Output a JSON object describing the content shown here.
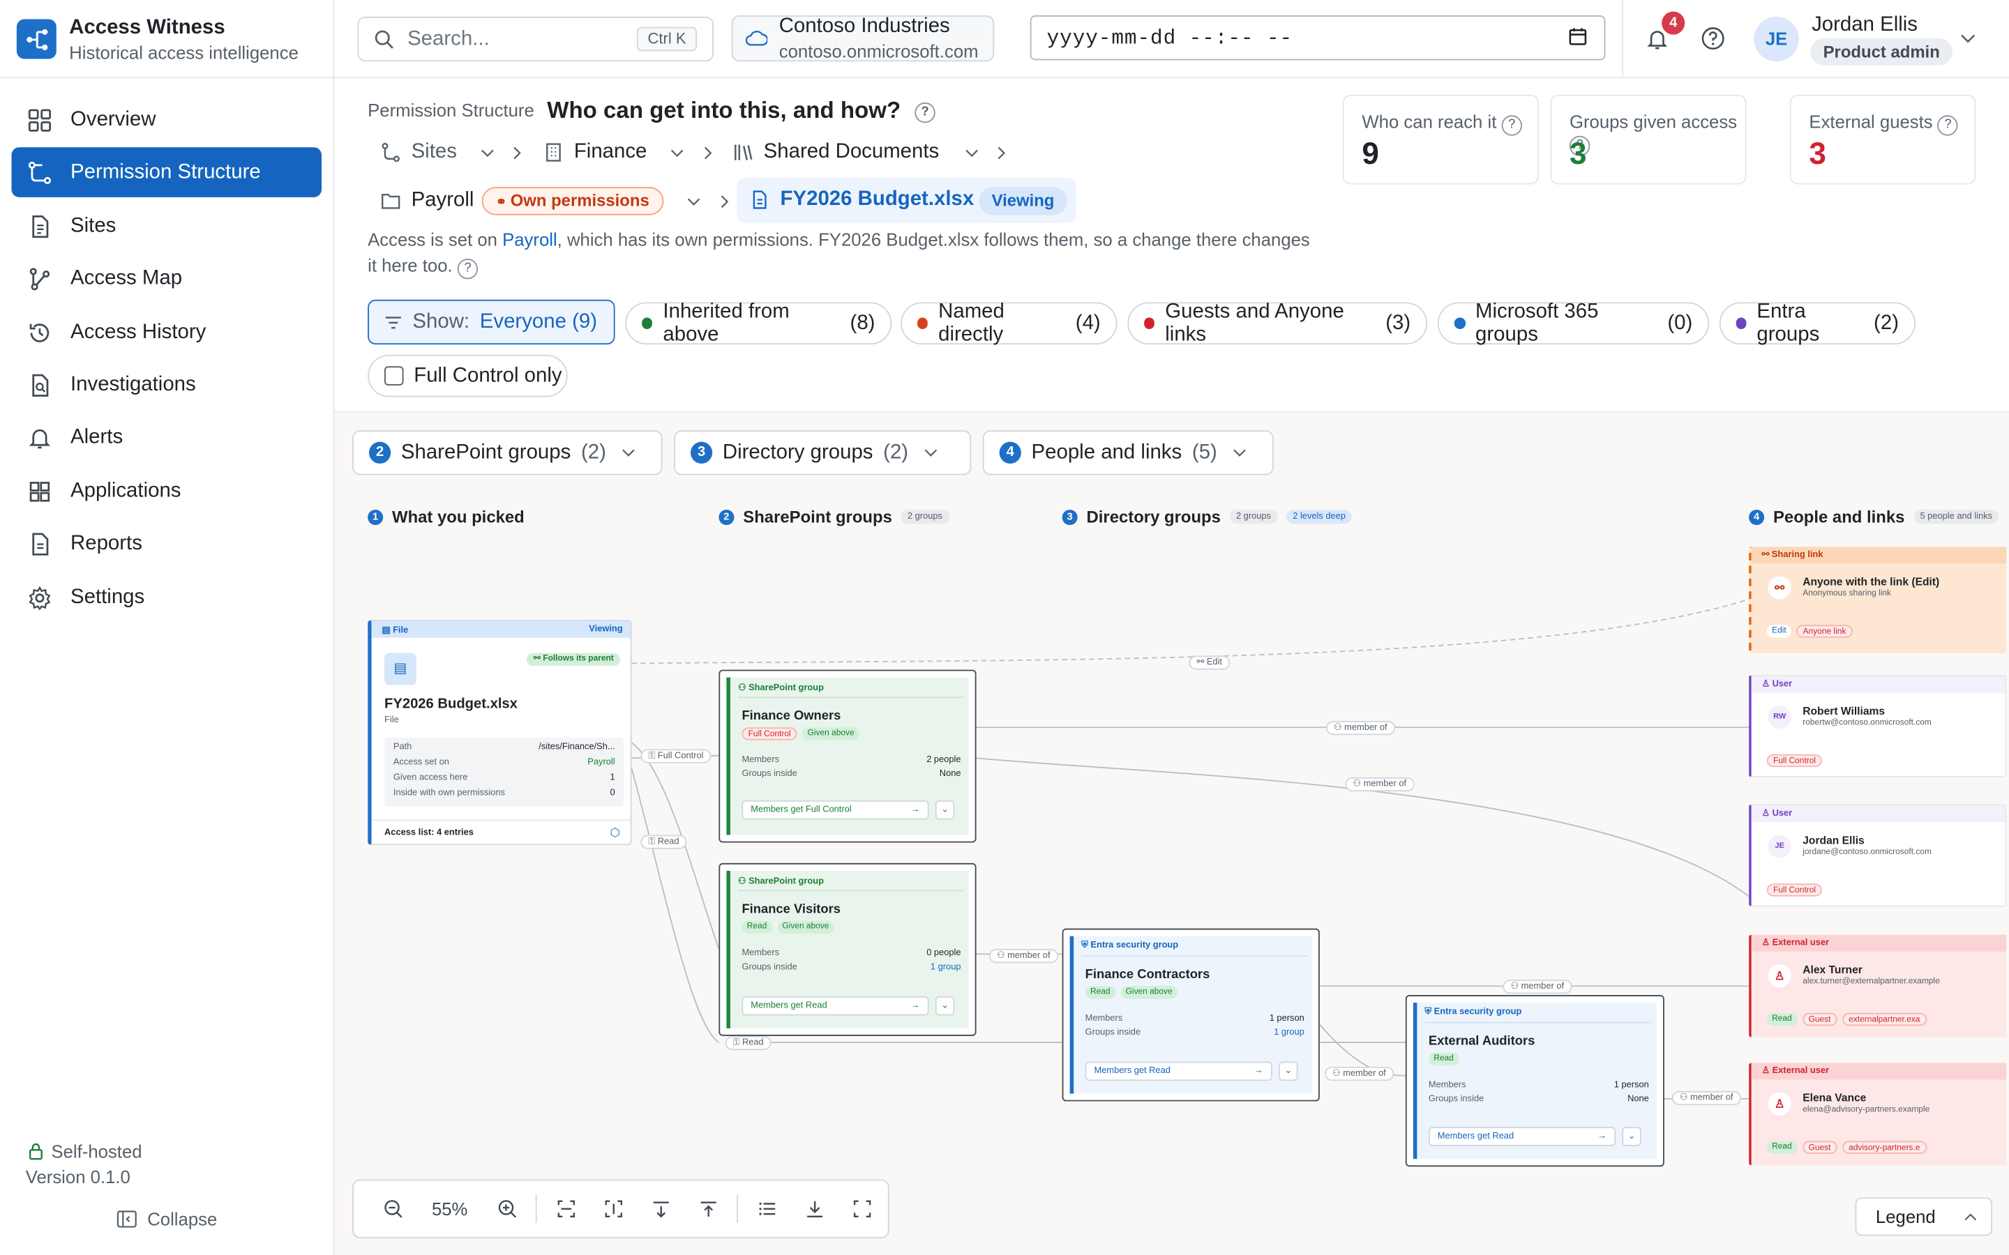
{
  "brand": {
    "title": "Access Witness",
    "subtitle": "Historical access intelligence"
  },
  "nav": [
    {
      "label": "Overview",
      "icon": "grid-icon"
    },
    {
      "label": "Permission Structure",
      "icon": "hierarchy-icon"
    },
    {
      "label": "Sites",
      "icon": "document-icon"
    },
    {
      "label": "Access Map",
      "icon": "graph-icon"
    },
    {
      "label": "Access History",
      "icon": "history-icon"
    },
    {
      "label": "Investigations",
      "icon": "search-doc-icon"
    },
    {
      "label": "Alerts",
      "icon": "bell-icon"
    },
    {
      "label": "Applications",
      "icon": "apps-icon"
    },
    {
      "label": "Reports",
      "icon": "report-icon"
    },
    {
      "label": "Settings",
      "icon": "gear-icon"
    }
  ],
  "sidebar_footer": {
    "hosting": "Self-hosted",
    "version": "Version 0.1.0",
    "collapse": "Collapse"
  },
  "topbar": {
    "search_placeholder": "Search...",
    "shortcut": "Ctrl K",
    "tenant_name": "Contoso Industries",
    "tenant_domain": "contoso.onmicrosoft.com",
    "datetime_placeholder": "yyyy-mm-dd --:-- --",
    "notification_count": "4",
    "user_initials": "JE",
    "user_name": "Jordan Ellis",
    "user_role": "Product admin"
  },
  "header": {
    "section": "Permission Structure",
    "title": "Who can get into this, and how?",
    "help": "?",
    "breadcrumb": [
      "Sites",
      "Finance",
      "Shared Documents",
      "Payroll",
      "FY2026 Budget.xlsx"
    ],
    "own_permissions": "Own permissions",
    "viewing": "Viewing",
    "desc_pre": "Access is set on ",
    "desc_link": "Payroll",
    "desc_post": ", which has its own permissions. FY2026 Budget.xlsx follows them, so a change there changes it here too."
  },
  "stats": [
    {
      "label": "Who can reach it",
      "value": "9",
      "color": "#1f2328"
    },
    {
      "label": "Groups given access",
      "value": "3",
      "color": "#1a7f37"
    },
    {
      "label": "External guests",
      "value": "3",
      "color": "#cf222e"
    }
  ],
  "filters": {
    "show_label": "Show:",
    "show_value": "Everyone (9)",
    "chips": [
      {
        "label": "Inherited from above",
        "count": "(8)",
        "color": "#1a7f37"
      },
      {
        "label": "Named directly",
        "count": "(4)",
        "color": "#d4441a"
      },
      {
        "label": "Guests and Anyone links",
        "count": "(3)",
        "color": "#cf222e"
      },
      {
        "label": "Microsoft 365 groups",
        "count": "(0)",
        "color": "#1e6fc8"
      },
      {
        "label": "Entra groups",
        "count": "(2)",
        "color": "#6f42c1"
      }
    ],
    "full_control": "Full Control only"
  },
  "stages": [
    {
      "num": "2",
      "label": "SharePoint groups",
      "count": "(2)"
    },
    {
      "num": "3",
      "label": "Directory groups",
      "count": "(2)"
    },
    {
      "num": "4",
      "label": "People and links",
      "count": "(5)"
    }
  ],
  "columns": [
    {
      "num": "1",
      "label": "What you picked",
      "tags": []
    },
    {
      "num": "2",
      "label": "SharePoint groups",
      "tags": [
        "2 groups"
      ]
    },
    {
      "num": "3",
      "label": "Directory groups",
      "tags": [
        "2 groups",
        "2 levels deep"
      ]
    },
    {
      "num": "4",
      "label": "People and links",
      "tags": [
        "5 people and links"
      ]
    }
  ],
  "file_node": {
    "kind": "File",
    "viewing": "Viewing",
    "follows": "Follows its parent",
    "name": "FY2026 Budget.xlsx",
    "type": "File",
    "rows": [
      [
        "Path",
        "/sites/Finance/Sh..."
      ],
      [
        "Access set on",
        "Payroll"
      ],
      [
        "Given access here",
        "1"
      ],
      [
        "Inside with own permissions",
        "0"
      ]
    ],
    "footer": "Access list: 4 entries"
  },
  "sp_groups": [
    {
      "kind": "SharePoint group",
      "name": "Finance Owners",
      "perm": "Full Control",
      "inherit": "Given above",
      "members": "2 people",
      "inside": "None",
      "btn": "Members get Full Control"
    },
    {
      "kind": "SharePoint group",
      "name": "Finance Visitors",
      "perm": "Read",
      "inherit": "Given above",
      "members": "0 people",
      "inside": "1 group",
      "btn": "Members get Read"
    }
  ],
  "dir_groups": [
    {
      "kind": "Entra security group",
      "name": "Finance Contractors",
      "perm": "Read",
      "inherit": "Given above",
      "members": "1 person",
      "inside": "1 group",
      "btn": "Members get Read"
    },
    {
      "kind": "Entra security group",
      "name": "External Auditors",
      "perm": "Read",
      "inherit": "",
      "members": "1 person",
      "inside": "None",
      "btn": "Members get Read"
    }
  ],
  "node_labels": {
    "members": "Members",
    "inside": "Groups inside"
  },
  "people": [
    {
      "kind": "Sharing link",
      "name": "Anyone with the link (Edit)",
      "sub": "Anonymous sharing link",
      "initials": "",
      "tags": [
        "Edit",
        "Anyone link"
      ]
    },
    {
      "kind": "User",
      "name": "Robert Williams",
      "sub": "robertw@contoso.onmicrosoft.com",
      "initials": "RW",
      "tags": [
        "Full Control"
      ]
    },
    {
      "kind": "User",
      "name": "Jordan Ellis",
      "sub": "jordane@contoso.onmicrosoft.com",
      "initials": "JE",
      "tags": [
        "Full Control"
      ]
    },
    {
      "kind": "External user",
      "name": "Alex Turner",
      "sub": "alex.turner@externalpartner.example",
      "initials": "",
      "tags": [
        "Read",
        "Guest",
        "externalpartner.exa"
      ]
    },
    {
      "kind": "External user",
      "name": "Elena Vance",
      "sub": "elena@advisory-partners.example",
      "initials": "",
      "tags": [
        "Read",
        "Guest",
        "advisory-partners.e"
      ]
    }
  ],
  "edges": {
    "edit": "Edit",
    "full_control": "Full Control",
    "read": "Read",
    "member_of": "member of"
  },
  "toolbar": {
    "zoom": "55%",
    "legend": "Legend"
  }
}
